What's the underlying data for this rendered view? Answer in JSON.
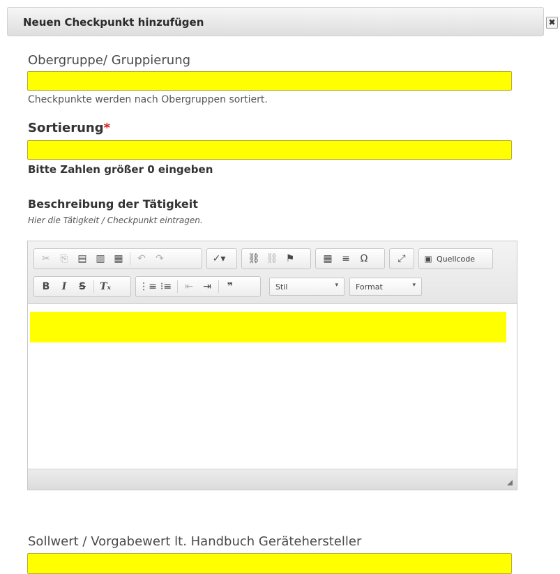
{
  "dialog": {
    "title": "Neuen Checkpunkt hinzufügen",
    "close_label": "✖"
  },
  "fields": {
    "obergruppe": {
      "label": "Obergruppe/ Gruppierung",
      "value": "",
      "hint": "Checkpunkte werden nach Obergruppen sortiert."
    },
    "sortierung": {
      "label": "Sortierung",
      "required_mark": "*",
      "value": "",
      "hint": "Bitte Zahlen größer 0 eingeben"
    },
    "beschreibung": {
      "label": "Beschreibung der Tätigkeit",
      "hint": "Hier die Tätigkeit / Checkpunkt eintragen.",
      "value": ""
    },
    "sollwert": {
      "label": "Sollwert / Vorgabewert lt. Handbuch Gerätehersteller",
      "value": ""
    }
  },
  "editor": {
    "toolbar": {
      "source_label": "Quellcode",
      "style_combo": "Stil",
      "format_combo": "Format"
    }
  },
  "colors": {
    "highlight": "#ffff00",
    "required": "#d21f1f"
  }
}
